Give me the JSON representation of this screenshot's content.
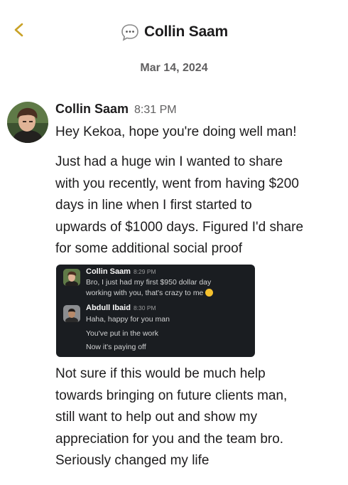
{
  "header": {
    "title": "Collin Saam"
  },
  "date_divider": "Mar 14, 2024",
  "message": {
    "sender": "Collin Saam",
    "time": "8:31 PM",
    "paragraph1": [
      "Hey Kekoa, hope you're doing well man!"
    ],
    "paragraph2": [
      "Just had a huge win I wanted to share",
      "with you recently, went from having $200",
      "days in line when I first started to",
      "upwards of $1000 days. Figured I'd share",
      "for some additional social proof"
    ],
    "paragraph3": [
      "Not sure if this would be much help",
      "towards bringing on future clients man,",
      "still want to help out and show my",
      "appreciation for you and the team bro.",
      "Seriously changed my life"
    ]
  },
  "screenshot": {
    "messages": [
      {
        "sender": "Collin Saam",
        "time": "8:29 PM",
        "lines": [
          "Bro, I just had my first $950 dollar day",
          "working with you, that's crazy to me"
        ]
      },
      {
        "sender": "Abdull Ibaid",
        "time": "8:30 PM",
        "lines": [
          "Haha, happy for you man",
          "You've put in the work",
          "Now it's paying off"
        ]
      }
    ]
  },
  "icons": {
    "back": "chevron-left-icon",
    "title": "speech-bubble-icon",
    "emoji": "grinning-face-emoji"
  },
  "colors": {
    "back_chevron": "#c9a227",
    "text": "#1d1c1d",
    "muted": "#616061",
    "embedded_bg": "#1a1d21"
  }
}
